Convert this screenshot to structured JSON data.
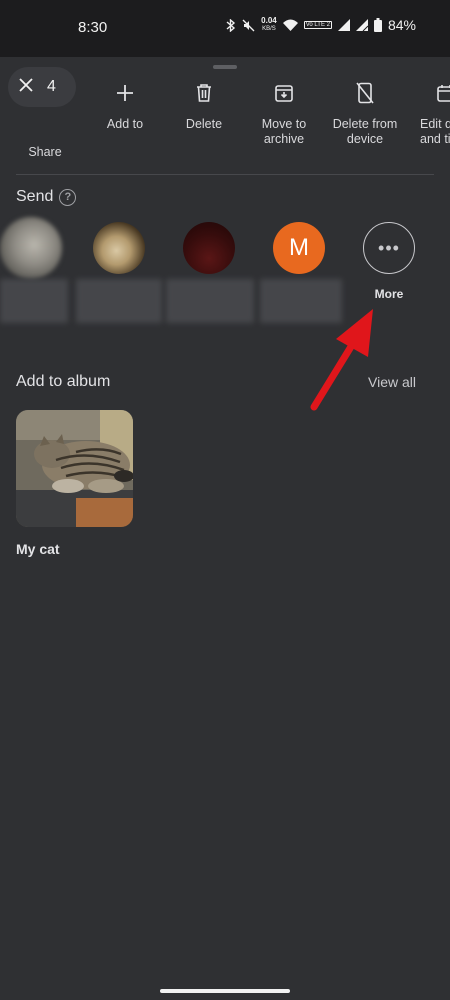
{
  "status_bar": {
    "time": "8:30",
    "net_speed_value": "0.04",
    "net_speed_unit": "KB/S",
    "volte_label": "Vo LTE 2",
    "battery": "84%"
  },
  "selection": {
    "count": "4"
  },
  "actions": [
    {
      "label": "Share",
      "icon": "share-icon"
    },
    {
      "label": "Add to",
      "icon": "plus-icon"
    },
    {
      "label": "Delete",
      "icon": "trash-icon"
    },
    {
      "label": "Move to archive",
      "icon": "archive-icon"
    },
    {
      "label": "Delete from device",
      "icon": "delete-device-icon"
    },
    {
      "label": "Edit d and ti",
      "icon": "calendar-edit-icon"
    }
  ],
  "send": {
    "title": "Send",
    "contacts": [
      {
        "initial": ""
      },
      {
        "initial": ""
      },
      {
        "initial": ""
      },
      {
        "initial": "M"
      }
    ],
    "more_label": "More"
  },
  "album": {
    "title": "Add to album",
    "view_all": "View all",
    "items": [
      {
        "name": "My cat"
      }
    ]
  },
  "colors": {
    "status_bar_bg": "#1c1c1e",
    "sheet_bg": "#2f3033",
    "contact_m": "#e8691f",
    "annotation_arrow": "#e0161b"
  }
}
